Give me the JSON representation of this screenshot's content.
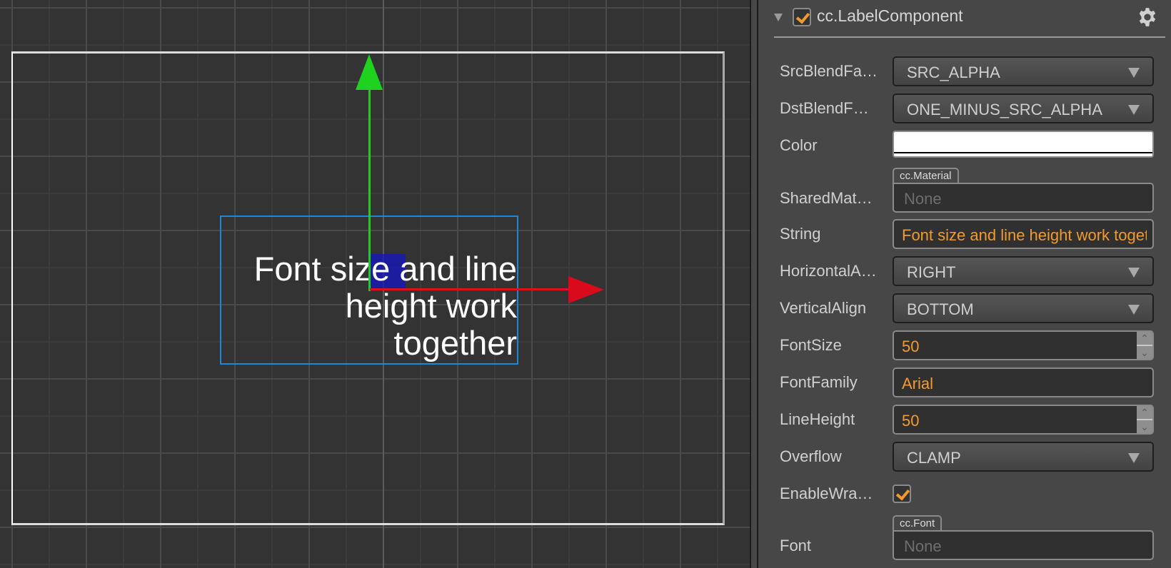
{
  "scene": {
    "label_lines": [
      "Font size and line",
      "height work",
      "together"
    ]
  },
  "inspector": {
    "component": {
      "title": "cc.LabelComponent",
      "enabled": true
    },
    "properties": [
      {
        "label": "SrcBlendFa…",
        "type": "select",
        "value": "SRC_ALPHA"
      },
      {
        "label": "DstBlendF…",
        "type": "select",
        "value": "ONE_MINUS_SRC_ALPHA"
      },
      {
        "label": "Color",
        "type": "color",
        "value": "#ffffff"
      },
      {
        "label": "SharedMat…",
        "type": "asset",
        "asset_type": "cc.Material",
        "value": "None"
      },
      {
        "label": "String",
        "type": "text",
        "value": "Font size and line height work together"
      },
      {
        "label": "HorizontalA…",
        "type": "select",
        "value": "RIGHT"
      },
      {
        "label": "VerticalAlign",
        "type": "select",
        "value": "BOTTOM"
      },
      {
        "label": "FontSize",
        "type": "number",
        "value": "50"
      },
      {
        "label": "FontFamily",
        "type": "text",
        "value": "Arial"
      },
      {
        "label": "LineHeight",
        "type": "number",
        "value": "50"
      },
      {
        "label": "Overflow",
        "type": "select",
        "value": "CLAMP"
      },
      {
        "label": "EnableWra…",
        "type": "checkbox",
        "checked": true
      },
      {
        "label": "Font",
        "type": "asset",
        "asset_type": "cc.Font",
        "value": "None"
      }
    ]
  },
  "colors": {
    "accent": "#f39a2e",
    "gizmo_x": "#d80a1c",
    "gizmo_y": "#1ed21e",
    "selection": "#1f87d6"
  },
  "icons": {
    "gear": "gear-icon",
    "fold": "triangle-down-icon",
    "caret": "caret-down-icon",
    "check": "checkmark-icon"
  }
}
